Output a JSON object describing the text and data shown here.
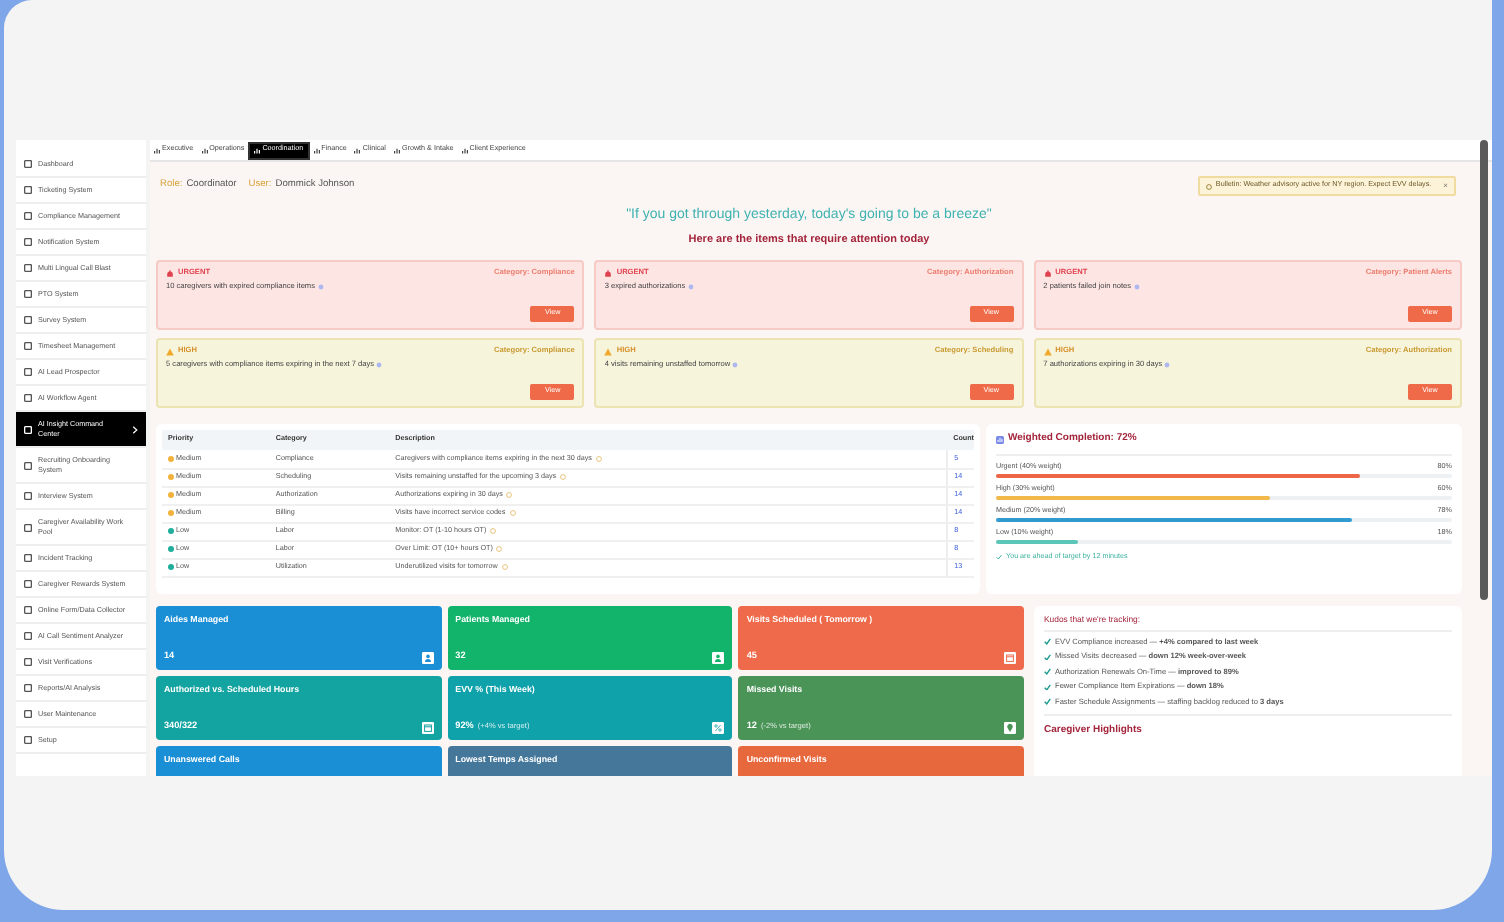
{
  "sidebar": {
    "items": [
      {
        "label": "Dashboard",
        "selected": false
      },
      {
        "label": "Ticketing System",
        "selected": false
      },
      {
        "label": "Compliance Management",
        "selected": false
      },
      {
        "label": "Notification System",
        "selected": false
      },
      {
        "label": "Multi Lingual Call Blast",
        "selected": false
      },
      {
        "label": "PTO System",
        "selected": false
      },
      {
        "label": "Survey System",
        "selected": false
      },
      {
        "label": "Timesheet Management",
        "selected": false
      },
      {
        "label": "AI Lead Prospector",
        "selected": false
      },
      {
        "label": "AI Workflow Agent",
        "selected": false
      },
      {
        "label": "AI Insight Command Center",
        "selected": true
      },
      {
        "label": "Recruiting Onboarding System",
        "selected": false
      },
      {
        "label": "Interview System",
        "selected": false
      },
      {
        "label": "Caregiver Availability Work Pool",
        "selected": false
      },
      {
        "label": "Incident Tracking",
        "selected": false
      },
      {
        "label": "Caregiver Rewards System",
        "selected": false
      },
      {
        "label": "Online Form/Data Collector",
        "selected": false
      },
      {
        "label": "AI Call Sentiment Analyzer",
        "selected": false
      },
      {
        "label": "Visit Verifications",
        "selected": false
      },
      {
        "label": "Reports/AI Analysis",
        "selected": false
      },
      {
        "label": "User Maintenance",
        "selected": false
      },
      {
        "label": "Setup",
        "selected": false
      }
    ]
  },
  "tabs": [
    {
      "label": "Executive",
      "selected": false
    },
    {
      "label": "Operations",
      "selected": false
    },
    {
      "label": "Coordination",
      "selected": true
    },
    {
      "label": "Finance",
      "selected": false
    },
    {
      "label": "Clinical",
      "selected": false
    },
    {
      "label": "Growth & Intake",
      "selected": false
    },
    {
      "label": "Client Experience",
      "selected": false
    }
  ],
  "header": {
    "role_label": "Role:",
    "role": "Coordinator",
    "user_label": "User:",
    "user": "Dommick Johnson"
  },
  "bulletin": {
    "text": "Bulletin: Weather advisory active for NY region. Expect EVV delays.",
    "close": "×"
  },
  "quote": "\"If you got through yesterday, today's going to be a breeze\"",
  "attention_heading": "Here are the items that require attention today",
  "alerts": [
    {
      "kind": "urgent",
      "badge": "URGENT",
      "category": "Category: Compliance",
      "text": "10 caregivers with expired compliance items",
      "button": "View"
    },
    {
      "kind": "urgent",
      "badge": "URGENT",
      "category": "Category: Authorization",
      "text": "3 expired authorizations",
      "button": "View"
    },
    {
      "kind": "urgent",
      "badge": "URGENT",
      "category": "Category: Patient Alerts",
      "text": "2 patients failed join notes",
      "button": "View"
    },
    {
      "kind": "high",
      "badge": "HIGH",
      "category": "Category: Compliance",
      "text": "5 caregivers with compliance items expiring in the next 7 days",
      "button": "View"
    },
    {
      "kind": "high",
      "badge": "HIGH",
      "category": "Category: Scheduling",
      "text": "4 visits remaining unstaffed tomorrow",
      "button": "View"
    },
    {
      "kind": "high",
      "badge": "HIGH",
      "category": "Category: Authorization",
      "text": "7 authorizations expiring in 30 days",
      "button": "View"
    }
  ],
  "priority_table": {
    "columns": [
      "Priority",
      "Category",
      "Description",
      "Count"
    ],
    "rows": [
      {
        "priority": "Medium",
        "color": "#f2b33d",
        "category": "Compliance",
        "description": "Caregivers with compliance items expiring in the next 30 days",
        "count": "5"
      },
      {
        "priority": "Medium",
        "color": "#f2b33d",
        "category": "Scheduling",
        "description": "Visits remaining unstaffed for the upcoming 3 days",
        "count": "14"
      },
      {
        "priority": "Medium",
        "color": "#f2b33d",
        "category": "Authorization",
        "description": "Authorizations expiring in 30 days",
        "count": "14"
      },
      {
        "priority": "Medium",
        "color": "#f2b33d",
        "category": "Billing",
        "description": "Visits have incorrect service codes",
        "count": "14"
      },
      {
        "priority": "Low",
        "color": "#1fae9b",
        "category": "Labor",
        "description": "Monitor: OT (1-10 hours OT)",
        "count": "8"
      },
      {
        "priority": "Low",
        "color": "#1fae9b",
        "category": "Labor",
        "description": "Over Limit: OT (10+ hours OT)",
        "count": "8"
      },
      {
        "priority": "Low",
        "color": "#1fae9b",
        "category": "Utilization",
        "description": "Underutilized visits for tomorrow",
        "count": "13"
      }
    ]
  },
  "weighted_completion": {
    "title": "Weighted Completion: 72%",
    "rows": [
      {
        "label": "Urgent (40% weight)",
        "reading": "80%",
        "level": 0.8,
        "color": "#ee6547"
      },
      {
        "label": "High (30% weight)",
        "reading": "60%",
        "level": 0.6,
        "color": "#f3b84a"
      },
      {
        "label": "Medium (20% weight)",
        "reading": "78%",
        "level": 0.78,
        "color": "#2f9bd0"
      },
      {
        "label": "Low (10% weight)",
        "reading": "18%",
        "level": 0.18,
        "color": "#5cc7b8"
      }
    ],
    "footer": "You are ahead of target by 12 minutes"
  },
  "stats": [
    {
      "title": "Aides Managed",
      "value": "14",
      "color": "#1a8fd6"
    },
    {
      "title": "Patients Managed",
      "value": "32",
      "color": "#12b36a"
    },
    {
      "title": "Visits Scheduled ( Tomorrow )",
      "value": "45",
      "color": "#ef6a4a"
    },
    {
      "title": "Authorized vs. Scheduled Hours",
      "value": "340/322",
      "color": "#13a3a0"
    },
    {
      "title": "EVV % (This Week)",
      "value": "92%",
      "note": "(+4% vs target)",
      "color": "#0fa2aa"
    },
    {
      "title": "Missed Visits",
      "value": "12",
      "note": "(-2% vs target)",
      "color": "#4a9458"
    },
    {
      "title": "Unanswered Calls",
      "color": "#1a8fd6"
    },
    {
      "title": "Lowest Temps Assigned",
      "color": "#44779a"
    },
    {
      "title": "Unconfirmed Visits",
      "color": "#e8683e"
    }
  ],
  "kudos": {
    "title": "Kudos that we're tracking:",
    "items": [
      "EVV Compliance increased — **+4% compared to last week**",
      "Missed Visits decreased — **down 12% week-over-week**",
      "Authorization Renewals On-Time — **improved to 89%**",
      "Fewer Compliance Item Expirations — **down 18%**",
      "Faster Schedule Assignments — staffing backlog reduced to **3 days**"
    ],
    "highlights_title": "Caregiver Highlights"
  }
}
